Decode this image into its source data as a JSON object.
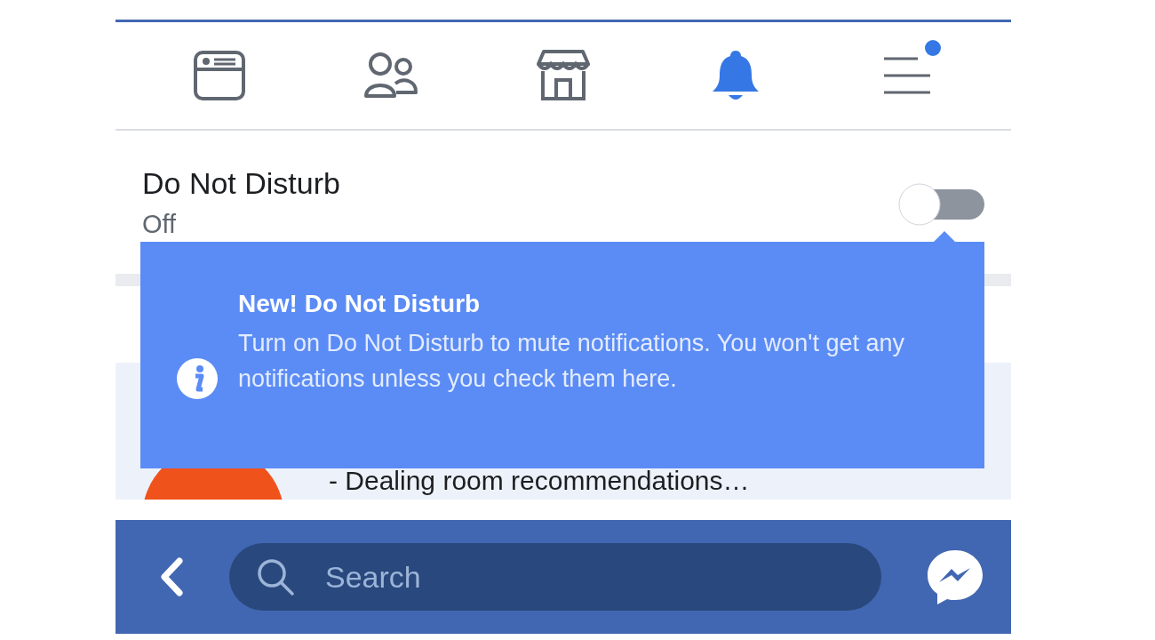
{
  "nav_tabs": [
    {
      "kind": "feed",
      "selected": false,
      "badge": false
    },
    {
      "kind": "friends",
      "selected": false,
      "badge": false
    },
    {
      "kind": "marketplace",
      "selected": false,
      "badge": false
    },
    {
      "kind": "notifications",
      "selected": true,
      "badge": false
    },
    {
      "kind": "menu",
      "selected": false,
      "badge": true
    }
  ],
  "setting": {
    "title": "Do Not Disturb",
    "status": "Off",
    "on": false
  },
  "tooltip": {
    "title": "New! Do Not Disturb",
    "body": "Turn on Do Not Disturb to mute notifications. You won't get any notifications unless you check them here."
  },
  "notification": {
    "text": "- Dealing room recommendations…"
  },
  "search_bar": {
    "placeholder": "Search"
  }
}
